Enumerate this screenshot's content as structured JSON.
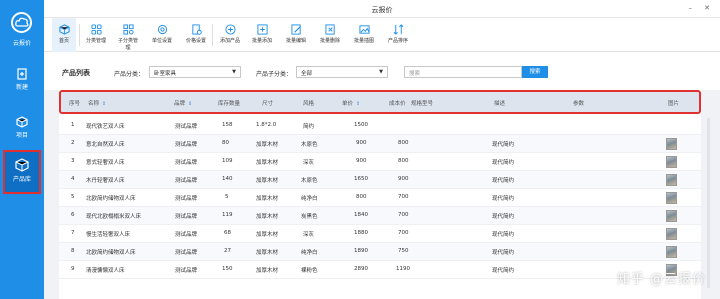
{
  "app": {
    "title": "云报价",
    "logo_label": "云报价"
  },
  "window": {
    "minimize": "–",
    "close": "✕"
  },
  "sidebar": {
    "items": [
      {
        "label": "新建",
        "icon": "new-doc-icon"
      },
      {
        "label": "项目",
        "icon": "project-box-icon"
      },
      {
        "label": "产品库",
        "icon": "product-cube-icon",
        "active": true
      }
    ]
  },
  "toolbar": {
    "buttons": [
      {
        "label": "首页",
        "icon": "home-icon"
      },
      {
        "label": "分类管理",
        "icon": "category-icon"
      },
      {
        "label": "子分类管理",
        "icon": "subcategory-icon"
      },
      {
        "label": "单位设置",
        "icon": "unit-settings-icon"
      },
      {
        "label": "价格设置",
        "icon": "price-settings-icon"
      },
      {
        "label": "添加产品",
        "icon": "add-product-icon"
      },
      {
        "label": "批量添加",
        "icon": "batch-add-icon"
      },
      {
        "label": "批量编辑",
        "icon": "batch-edit-icon"
      },
      {
        "label": "批量删除",
        "icon": "batch-delete-icon"
      },
      {
        "label": "批量插图",
        "icon": "batch-image-icon"
      },
      {
        "label": "产品排序",
        "icon": "sort-icon"
      }
    ]
  },
  "filters": {
    "list_title": "产品列表",
    "category_label": "产品分类：",
    "category_value": "卧室家具",
    "subcategory_label": "产品子分类：",
    "subcategory_value": "全部",
    "search_placeholder": "搜索",
    "search_button": "搜索"
  },
  "table": {
    "headers": [
      "序号",
      "名称",
      "品牌",
      "库存数量",
      "尺寸",
      "风格",
      "单价",
      "成本价",
      "规格型号",
      "描述",
      "参数",
      "图片"
    ],
    "rows": [
      {
        "no": "1",
        "name": "现代铁艺双人床",
        "brand": "测试品牌",
        "stock": "158",
        "size": "1.8*2.0",
        "style": "简约",
        "price": "1500",
        "cost": "",
        "desc": "",
        "image": false
      },
      {
        "no": "2",
        "name": "意北自然双人床",
        "brand": "测试品牌",
        "stock": "80",
        "size": "加厚木材",
        "style": "木原色",
        "price": "900",
        "cost": "800",
        "desc": "现代简约",
        "image": true
      },
      {
        "no": "3",
        "name": "意式轻奢双人床",
        "brand": "测试品牌",
        "stock": "109",
        "size": "加厚木材",
        "style": "深灰",
        "price": "900",
        "cost": "800",
        "desc": "现代简约",
        "image": true
      },
      {
        "no": "4",
        "name": "木丹轻奢双人床",
        "brand": "测试品牌",
        "stock": "140",
        "size": "加厚木材",
        "style": "木原色",
        "price": "1650",
        "cost": "900",
        "desc": "现代简约",
        "image": true
      },
      {
        "no": "5",
        "name": "北欧简约储物双人床",
        "brand": "测试品牌",
        "stock": "5",
        "size": "加厚木材",
        "style": "纯净白",
        "price": "800",
        "cost": "700",
        "desc": "现代简约",
        "image": true
      },
      {
        "no": "6",
        "name": "现代北欧榻榻米双人床",
        "brand": "测试品牌",
        "stock": "119",
        "size": "加厚木材",
        "style": "炭黑色",
        "price": "1840",
        "cost": "700",
        "desc": "现代简约",
        "image": true
      },
      {
        "no": "7",
        "name": "慢生活轻奢双人床",
        "brand": "测试品牌",
        "stock": "68",
        "size": "加厚木材",
        "style": "深灰",
        "price": "1880",
        "cost": "700",
        "desc": "现代简约",
        "image": true
      },
      {
        "no": "8",
        "name": "北欧简约储物双人床",
        "brand": "测试品牌",
        "stock": "27",
        "size": "加厚木材",
        "style": "纯净白",
        "price": "1890",
        "cost": "750",
        "desc": "现代简约",
        "image": true
      },
      {
        "no": "9",
        "name": "清漫慵懒双人床",
        "brand": "测试品牌",
        "stock": "150",
        "size": "加厚木材",
        "style": "裸粉色",
        "price": "2890",
        "cost": "1190",
        "desc": "现代简约",
        "image": true
      }
    ]
  },
  "watermark": "知乎 @云报价",
  "colors": {
    "primary": "#1e8ee6",
    "highlight": "#e03030"
  }
}
